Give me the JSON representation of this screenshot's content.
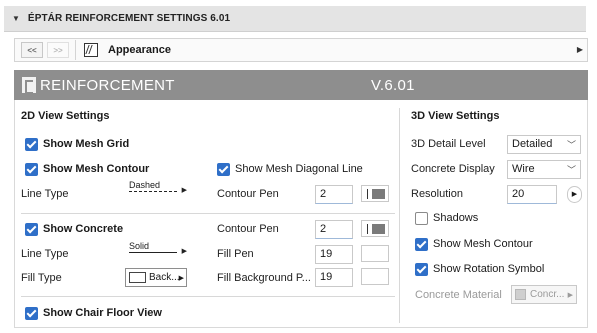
{
  "titlebar": {
    "title": "ÉPTÁR REINFORCEMENT SETTINGS 6.01"
  },
  "nav": {
    "back": "<<",
    "forward": ">>",
    "page": "Appearance"
  },
  "banner": {
    "title": "REINFORCEMENT",
    "version": "V.6.01"
  },
  "view2d": {
    "heading": "2D View Settings",
    "show_mesh_grid": {
      "label": "Show Mesh Grid",
      "checked": true
    },
    "show_mesh_contour": {
      "label": "Show Mesh Contour",
      "checked": true
    },
    "show_mesh_diagonal": {
      "label": "Show Mesh Diagonal Line",
      "checked": true
    },
    "mesh_line_type": {
      "label": "Line Type",
      "value": "Dashed"
    },
    "mesh_contour_pen": {
      "label": "Contour Pen",
      "value": "2"
    },
    "show_concrete": {
      "label": "Show Concrete",
      "checked": true
    },
    "concrete_contour_pen": {
      "label": "Contour Pen",
      "value": "2"
    },
    "concrete_line_type": {
      "label": "Line Type",
      "value": "Solid"
    },
    "fill_pen": {
      "label": "Fill Pen",
      "value": "19"
    },
    "fill_type": {
      "label": "Fill Type",
      "value": "Back..."
    },
    "fill_bg_pen": {
      "label": "Fill Background P...",
      "value": "19"
    },
    "show_chair_floor": {
      "label": "Show Chair Floor View",
      "checked": true
    }
  },
  "view3d": {
    "heading": "3D View Settings",
    "detail_level": {
      "label": "3D Detail Level",
      "value": "Detailed"
    },
    "concrete_display": {
      "label": "Concrete Display",
      "value": "Wire"
    },
    "resolution": {
      "label": "Resolution",
      "value": "20"
    },
    "shadows": {
      "label": "Shadows",
      "checked": false
    },
    "show_mesh_contour": {
      "label": "Show Mesh Contour",
      "checked": true
    },
    "show_rotation_symbol": {
      "label": "Show Rotation Symbol",
      "checked": true
    },
    "concrete_material": {
      "label": "Concrete Material",
      "value": "Concr..."
    }
  },
  "colors": {
    "accent": "#2f6fc8",
    "banner": "#8e8e8e"
  }
}
